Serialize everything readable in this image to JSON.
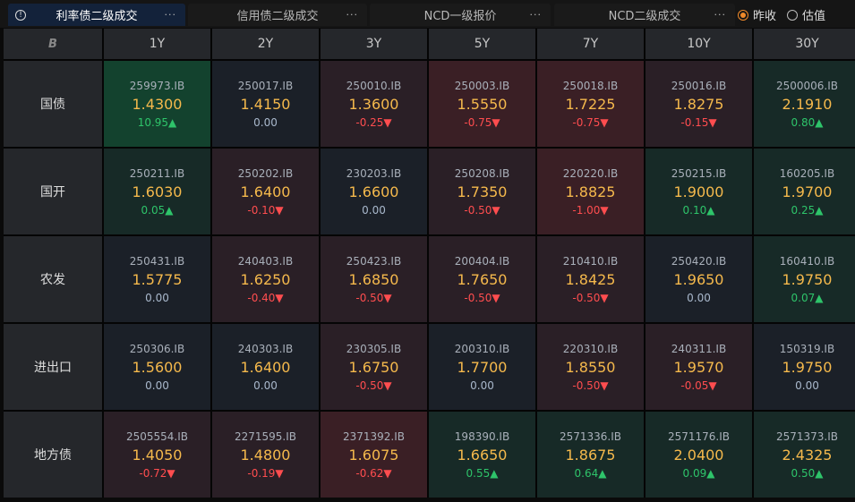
{
  "tabs": [
    {
      "label": "利率债二级成交",
      "active": true
    },
    {
      "label": "信用债二级成交"
    },
    {
      "label": "NCD一级报价"
    },
    {
      "label": "NCD二级成交"
    }
  ],
  "more_label": "···",
  "radios": [
    {
      "label": "昨收",
      "checked": true
    },
    {
      "label": "估值",
      "checked": false
    }
  ],
  "corner_logo": "B",
  "columns": [
    "1Y",
    "2Y",
    "3Y",
    "5Y",
    "7Y",
    "10Y",
    "30Y"
  ],
  "colors": {
    "up": "#2ec46a",
    "down": "#ff4d4f",
    "value": "#f5b94c",
    "accent": "#f08a2a"
  },
  "rows": [
    {
      "label": "国债",
      "cells": [
        {
          "code": "259973.IB",
          "value": "1.4300",
          "change": "10.95▲",
          "dir": "up",
          "tone": "g2"
        },
        {
          "code": "250017.IB",
          "value": "1.4150",
          "change": "0.00",
          "dir": "flat",
          "tone": "n"
        },
        {
          "code": "250010.IB",
          "value": "1.3600",
          "change": "-0.25▼",
          "dir": "down",
          "tone": "r1"
        },
        {
          "code": "250003.IB",
          "value": "1.5550",
          "change": "-0.75▼",
          "dir": "down",
          "tone": "r2"
        },
        {
          "code": "250018.IB",
          "value": "1.7225",
          "change": "-0.75▼",
          "dir": "down",
          "tone": "r2"
        },
        {
          "code": "250016.IB",
          "value": "1.8275",
          "change": "-0.15▼",
          "dir": "down",
          "tone": "r1"
        },
        {
          "code": "2500006.IB",
          "value": "2.1910",
          "change": "0.80▲",
          "dir": "up",
          "tone": "g1"
        }
      ]
    },
    {
      "label": "国开",
      "cells": [
        {
          "code": "250211.IB",
          "value": "1.6030",
          "change": "0.05▲",
          "dir": "up",
          "tone": "g1"
        },
        {
          "code": "250202.IB",
          "value": "1.6400",
          "change": "-0.10▼",
          "dir": "down",
          "tone": "r1"
        },
        {
          "code": "230203.IB",
          "value": "1.6600",
          "change": "0.00",
          "dir": "flat",
          "tone": "n"
        },
        {
          "code": "250208.IB",
          "value": "1.7350",
          "change": "-0.50▼",
          "dir": "down",
          "tone": "r1"
        },
        {
          "code": "220220.IB",
          "value": "1.8825",
          "change": "-1.00▼",
          "dir": "down",
          "tone": "r2"
        },
        {
          "code": "250215.IB",
          "value": "1.9000",
          "change": "0.10▲",
          "dir": "up",
          "tone": "g1"
        },
        {
          "code": "160205.IB",
          "value": "1.9700",
          "change": "0.25▲",
          "dir": "up",
          "tone": "g1"
        }
      ]
    },
    {
      "label": "农发",
      "cells": [
        {
          "code": "250431.IB",
          "value": "1.5775",
          "change": "0.00",
          "dir": "flat",
          "tone": "n"
        },
        {
          "code": "240403.IB",
          "value": "1.6250",
          "change": "-0.40▼",
          "dir": "down",
          "tone": "r1"
        },
        {
          "code": "250423.IB",
          "value": "1.6850",
          "change": "-0.50▼",
          "dir": "down",
          "tone": "r1"
        },
        {
          "code": "200404.IB",
          "value": "1.7650",
          "change": "-0.50▼",
          "dir": "down",
          "tone": "r1"
        },
        {
          "code": "210410.IB",
          "value": "1.8425",
          "change": "-0.50▼",
          "dir": "down",
          "tone": "r1"
        },
        {
          "code": "250420.IB",
          "value": "1.9650",
          "change": "0.00",
          "dir": "flat",
          "tone": "n"
        },
        {
          "code": "160410.IB",
          "value": "1.9750",
          "change": "0.07▲",
          "dir": "up",
          "tone": "g1"
        }
      ]
    },
    {
      "label": "进出口",
      "cells": [
        {
          "code": "250306.IB",
          "value": "1.5600",
          "change": "0.00",
          "dir": "flat",
          "tone": "n"
        },
        {
          "code": "240303.IB",
          "value": "1.6400",
          "change": "0.00",
          "dir": "flat",
          "tone": "n"
        },
        {
          "code": "230305.IB",
          "value": "1.6750",
          "change": "-0.50▼",
          "dir": "down",
          "tone": "r1"
        },
        {
          "code": "200310.IB",
          "value": "1.7700",
          "change": "0.00",
          "dir": "flat",
          "tone": "n"
        },
        {
          "code": "220310.IB",
          "value": "1.8550",
          "change": "-0.50▼",
          "dir": "down",
          "tone": "r1"
        },
        {
          "code": "240311.IB",
          "value": "1.9570",
          "change": "-0.05▼",
          "dir": "down",
          "tone": "r1"
        },
        {
          "code": "150319.IB",
          "value": "1.9750",
          "change": "0.00",
          "dir": "flat",
          "tone": "n"
        }
      ]
    },
    {
      "label": "地方债",
      "cells": [
        {
          "code": "2505554.IB",
          "value": "1.4050",
          "change": "-0.72▼",
          "dir": "down",
          "tone": "r1"
        },
        {
          "code": "2271595.IB",
          "value": "1.4800",
          "change": "-0.19▼",
          "dir": "down",
          "tone": "r1"
        },
        {
          "code": "2371392.IB",
          "value": "1.6075",
          "change": "-0.62▼",
          "dir": "down",
          "tone": "r2"
        },
        {
          "code": "198390.IB",
          "value": "1.6650",
          "change": "0.55▲",
          "dir": "up",
          "tone": "g1"
        },
        {
          "code": "2571336.IB",
          "value": "1.8675",
          "change": "0.64▲",
          "dir": "up",
          "tone": "g1"
        },
        {
          "code": "2571176.IB",
          "value": "2.0400",
          "change": "0.09▲",
          "dir": "up",
          "tone": "g1"
        },
        {
          "code": "2571373.IB",
          "value": "2.4325",
          "change": "0.50▲",
          "dir": "up",
          "tone": "g1"
        }
      ]
    }
  ]
}
